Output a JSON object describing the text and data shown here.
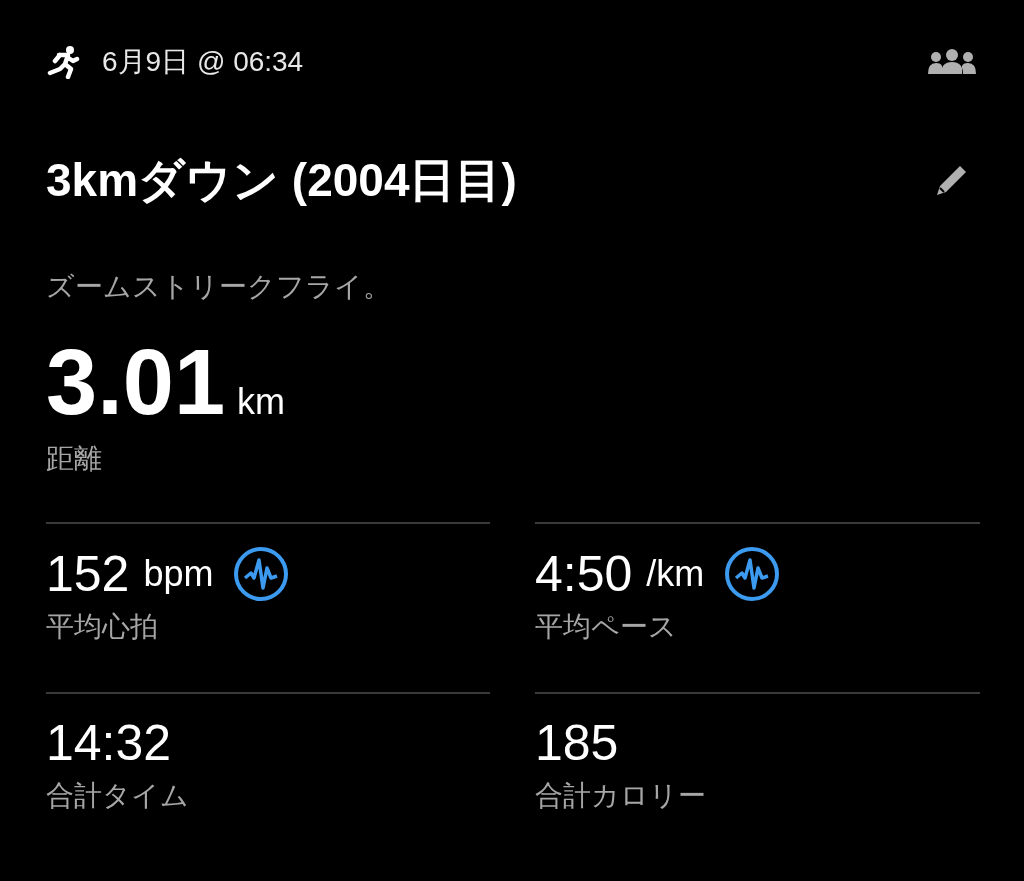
{
  "header": {
    "date": "6月9日 @ 06:34"
  },
  "title": "3kmダウン (2004日目)",
  "description": "ズームストリークフライ。",
  "distance": {
    "value": "3.01",
    "unit": "km",
    "label": "距離"
  },
  "stats": [
    {
      "kind": "live",
      "value": "152",
      "unit": "bpm",
      "label": "平均心拍"
    },
    {
      "kind": "live",
      "value": "4:50",
      "unit": "/km",
      "label": "平均ペース"
    },
    {
      "kind": "plain",
      "value": "14:32",
      "label": "合計タイム"
    },
    {
      "kind": "plain",
      "value": "185",
      "label": "合計カロリー"
    }
  ]
}
